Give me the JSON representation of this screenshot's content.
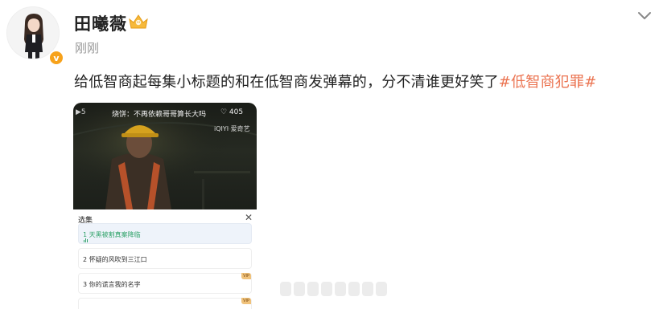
{
  "post": {
    "author": "田曦薇",
    "timestamp": "刚刚",
    "text": "给低智商起每集小标题的和在低智商发弹幕的，分不清谁更好笑了",
    "hashtag": "#低智商犯罪#",
    "verified_label": "v"
  },
  "icons": {
    "avatar": "avatar-icon",
    "verified": "verified-badge-icon",
    "member": "member-crown-icon",
    "menu": "chevron-down-icon"
  },
  "media": {
    "video": {
      "episode_indicator": "▶5",
      "danmu": "烧饼：不再依赖哥哥算长大吗",
      "likes": "♡ 405",
      "logo": "iQIYI 爱奇艺"
    },
    "panel": {
      "title": "选集",
      "close": "✕",
      "episodes": [
        {
          "label": "1 天黑被割真案降临",
          "active": true,
          "vip": ""
        },
        {
          "label": "2 怀疑的风吹到三江口",
          "active": false,
          "vip": ""
        },
        {
          "label": "3 你的谎言我的名字",
          "active": false,
          "vip": "VIP"
        },
        {
          "label": "",
          "active": false,
          "vip": "VIP"
        }
      ]
    }
  },
  "colors": {
    "hashtag": "#eb7350",
    "verified": "#f7a21b",
    "active_episode": "#30a36a"
  }
}
